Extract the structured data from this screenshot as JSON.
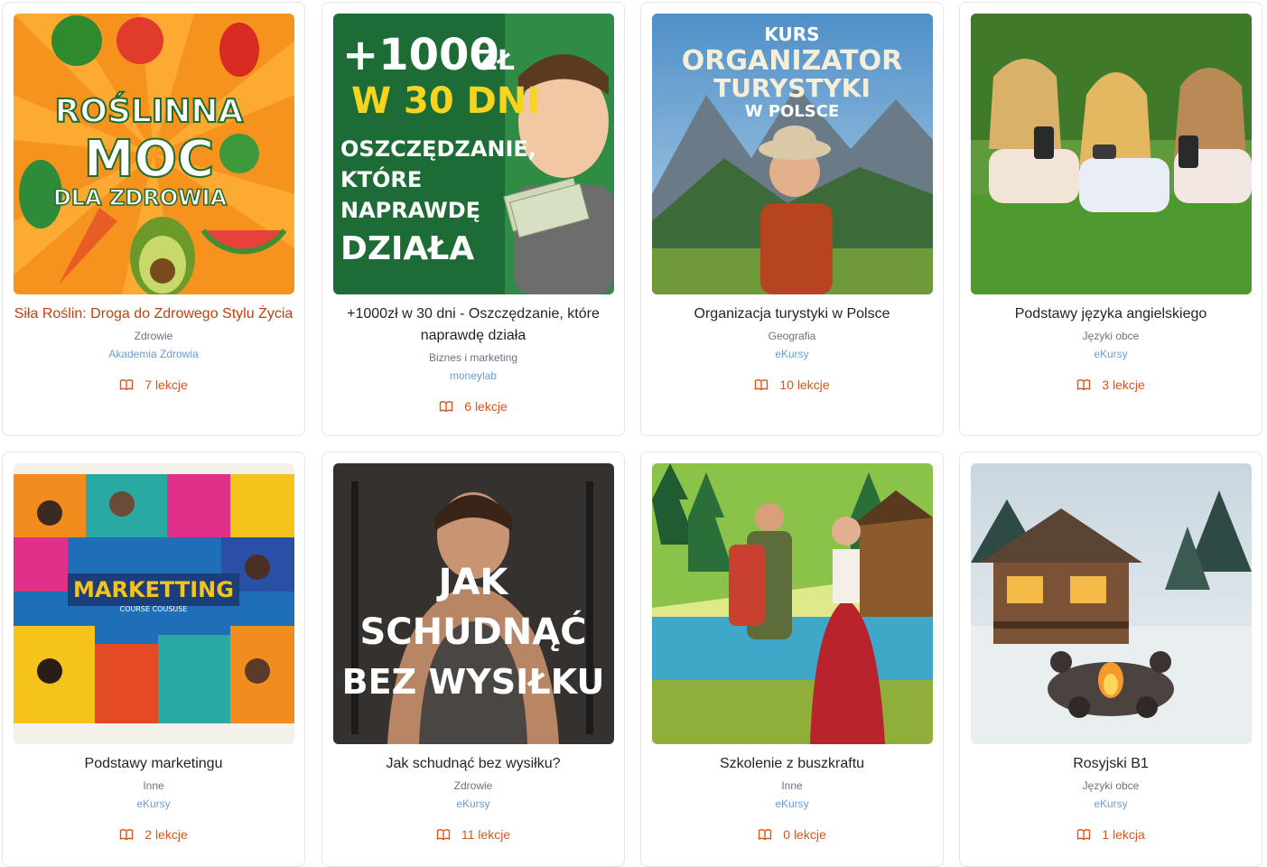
{
  "courses": [
    {
      "title": "Siła Roślin: Droga do Zdrowego Stylu Życia",
      "category": "Zdrowie",
      "author": "Akademia Zdrowia",
      "lessons": "7 lekcje",
      "image_text": [
        "ROŚLINNA",
        "MOC",
        "DLA ZDROWIA"
      ]
    },
    {
      "title": "+1000zł w 30 dni - Oszczędzanie, które naprawdę działa",
      "category": "Biznes i marketing",
      "author": "moneylab",
      "lessons": "6 lekcje",
      "image_text": [
        "+1000 ZŁ",
        "W 30 DNI",
        "OSZCZĘDZANIE,",
        "KTÓRE",
        "NAPRAWDĘ",
        "DZIAŁA"
      ]
    },
    {
      "title": "Organizacja turystyki w Polsce",
      "category": "Geografia",
      "author": "eKursy",
      "lessons": "10 lekcje",
      "image_text": [
        "KURS",
        "ORGANIZATOR",
        "TURYSTYKI",
        "W POLSCE"
      ]
    },
    {
      "title": "Podstawy języka angielskiego",
      "category": "Języki obce",
      "author": "eKursy",
      "lessons": "3 lekcje",
      "image_text": []
    },
    {
      "title": "Podstawy marketingu",
      "category": "Inne",
      "author": "eKursy",
      "lessons": "2 lekcje",
      "image_text": [
        "MARKETTING",
        "COURSE COUSUSE"
      ]
    },
    {
      "title": "Jak schudnąć bez wysiłku?",
      "category": "Zdrowie",
      "author": "eKursy",
      "lessons": "11 lekcje",
      "image_text": [
        "JAK",
        "SCHUDNĄĆ",
        "BEZ WYSIŁKU"
      ]
    },
    {
      "title": "Szkolenie z buszkraftu",
      "category": "Inne",
      "author": "eKursy",
      "lessons": "0 lekcje",
      "image_text": []
    },
    {
      "title": "Rosyjski B1",
      "category": "Języki obce",
      "author": "eKursy",
      "lessons": "1 lekcja",
      "image_text": []
    }
  ],
  "colors": {
    "title_highlight": "#c2410c",
    "lessons": "#d9561a",
    "author_link": "#6b9bd8",
    "category": "#6b7280"
  },
  "icons": {
    "lessons": "book-open-icon"
  }
}
